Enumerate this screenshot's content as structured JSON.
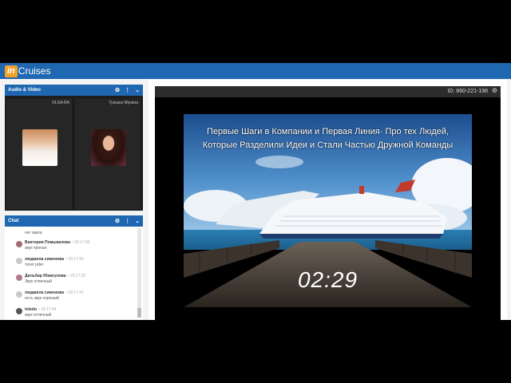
{
  "app": {
    "logo_in": "in",
    "logo_text": "Cruises"
  },
  "av_panel": {
    "title": "Audio & Video",
    "participants": [
      {
        "name": "OLGA RA"
      },
      {
        "name": "Гулькез Мусина"
      }
    ]
  },
  "chat_panel": {
    "title": "Chat",
    "messages": [
      {
        "author": "",
        "time": "",
        "text": "нет звука"
      },
      {
        "author": "Виктория Помыкалова",
        "time": "• 18:17:30",
        "text": "звук пропал"
      },
      {
        "author": "людмила симонова",
        "time": "• 18:17:30",
        "text": "тогит рder"
      },
      {
        "author": "Дильбар Юмагулова",
        "time": "• 18:17:32",
        "text": "Звук отличный"
      },
      {
        "author": "людмила симонова",
        "time": "• 18:17:41",
        "text": "есть звук хороший"
      },
      {
        "author": "toledo",
        "time": "• 18:17:44",
        "text": "звук отличный"
      }
    ]
  },
  "stage": {
    "meeting_id": "ID: 860-221-198",
    "caption_line1": "Первые Шаги в Компании и Первая Линия· Про тех Людей,",
    "caption_line2": "Которые Разделили Идеи и Стали Частью Дружной Команды",
    "timer": "02:29"
  },
  "icons": [
    "gear-icon",
    "more-icon",
    "chevron-down-icon",
    "settings-icon"
  ],
  "colors": {
    "brand_blue": "#1f67b1",
    "logo_orange": "#f2a12b"
  }
}
